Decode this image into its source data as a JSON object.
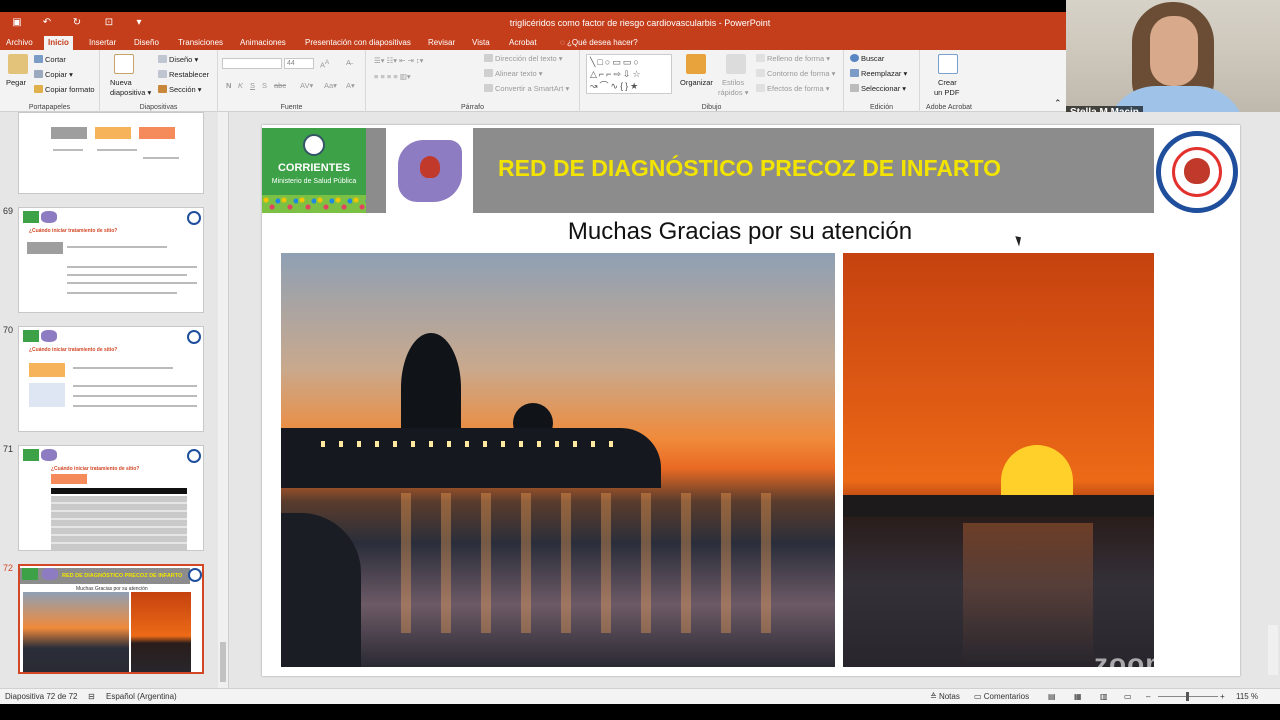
{
  "window": {
    "title": "triglicéridos como factor de riesgo cardiovascularbis - PowerPoint"
  },
  "ribbon_tabs": [
    {
      "label": "Archivo",
      "active": false
    },
    {
      "label": "Inicio",
      "active": true
    },
    {
      "label": "Insertar",
      "active": false
    },
    {
      "label": "Diseño",
      "active": false
    },
    {
      "label": "Transiciones",
      "active": false
    },
    {
      "label": "Animaciones",
      "active": false
    },
    {
      "label": "Presentación con diapositivas",
      "active": false
    },
    {
      "label": "Revisar",
      "active": false
    },
    {
      "label": "Vista",
      "active": false
    },
    {
      "label": "Acrobat",
      "active": false
    }
  ],
  "tell_me": "¿Qué desea hacer?",
  "ribbon": {
    "clipboard": {
      "paste": "Pegar",
      "cut": "Cortar",
      "copy": "Copiar",
      "format_painter": "Copiar formato",
      "label": "Portapapeles"
    },
    "slides": {
      "new_slide_1": "Nueva",
      "new_slide_2": "diapositiva",
      "layout": "Diseño",
      "reset": "Restablecer",
      "section": "Sección",
      "label": "Diapositivas"
    },
    "font": {
      "size": "44",
      "label": "Fuente",
      "bold": "N",
      "italic": "K",
      "underline": "S",
      "shadow": "S",
      "strike": "abc"
    },
    "paragraph": {
      "text_direction": "Dirección del texto",
      "align_text": "Alinear texto",
      "smartart": "Convertir a SmartArt",
      "label": "Párrafo"
    },
    "drawing": {
      "arrange": "Organizar",
      "quick_styles_1": "Estilos",
      "quick_styles_2": "rápidos",
      "fill": "Relleno de forma",
      "outline": "Contorno de forma",
      "effects": "Efectos de forma",
      "label": "Dibujo"
    },
    "editing": {
      "find": "Buscar",
      "replace": "Reemplazar",
      "select": "Seleccionar",
      "label": "Edición"
    },
    "acrobat": {
      "create_1": "Crear",
      "create_2": "un PDF",
      "label": "Adobe Acrobat"
    }
  },
  "webcam": {
    "name": "Stella M Macin"
  },
  "thumbnails": [
    {
      "number": "",
      "title": ""
    },
    {
      "number": "69",
      "title": "¿Cuándo iniciar tratamiento de sitio?"
    },
    {
      "number": "70",
      "title": "¿Cuándo iniciar tratamiento de sitio?"
    },
    {
      "number": "71",
      "title": "¿Cuándo iniciar tratamiento de sitio?"
    },
    {
      "number": "72",
      "title": "RED DE DIAGNÓSTICO PRECOZ DE INFARTO",
      "subtitle": "Muchas Gracias por su atención"
    }
  ],
  "slide": {
    "logo_left_title": "CORRIENTES",
    "logo_left_subtitle": "Ministerio de Salud Pública",
    "banner_title": "RED DE DIAGNÓSTICO PRECOZ DE INFARTO",
    "thanks": "Muchas Gracias por su atención"
  },
  "watermark": "zoom",
  "status": {
    "slide_counter": "Diapositiva 72 de 72",
    "language": "Español (Argentina)",
    "notes": "Notas",
    "comments": "Comentarios",
    "zoom": "115 %"
  },
  "colors": {
    "accent": "#c43e1c",
    "banner": "#8c8c8c",
    "banner_text": "#f2e400",
    "selected": "#d24726"
  }
}
